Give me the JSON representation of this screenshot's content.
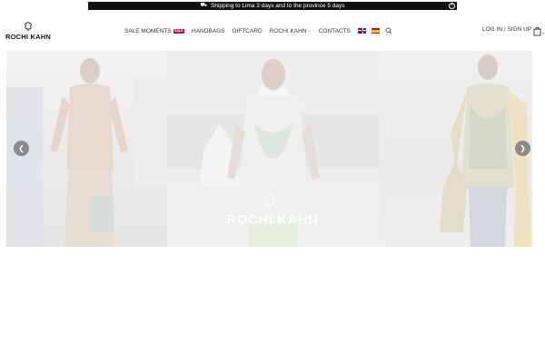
{
  "announcement": {
    "text": "Shipping to Lima 3 days and to the province 5 days",
    "truck_icon": "truck-icon",
    "close_icon": "close-icon"
  },
  "brand": {
    "name": "ROCHI KAHN"
  },
  "nav": {
    "items": [
      {
        "label": "SALE MOMENTS",
        "badge": "SALE"
      },
      {
        "label": "HANDBAGS"
      },
      {
        "label": "GIFTCARD"
      },
      {
        "label": "ROCHI KAHN",
        "has_dropdown": true
      }
    ],
    "contacts": "CONTACTS",
    "languages": [
      "English",
      "Español"
    ],
    "search_icon": "search-icon"
  },
  "account": {
    "label": "LOG IN / SIGN UP"
  },
  "cart": {
    "count": "0",
    "icon": "shopping-bag-icon"
  },
  "hero": {
    "watermark": "ROCHI KAHN",
    "prev_icon": "chevron-left-icon",
    "next_icon": "chevron-right-icon"
  },
  "colors": {
    "topbar_bg": "#111111",
    "badge": "#b0135a",
    "text": "#333333"
  }
}
